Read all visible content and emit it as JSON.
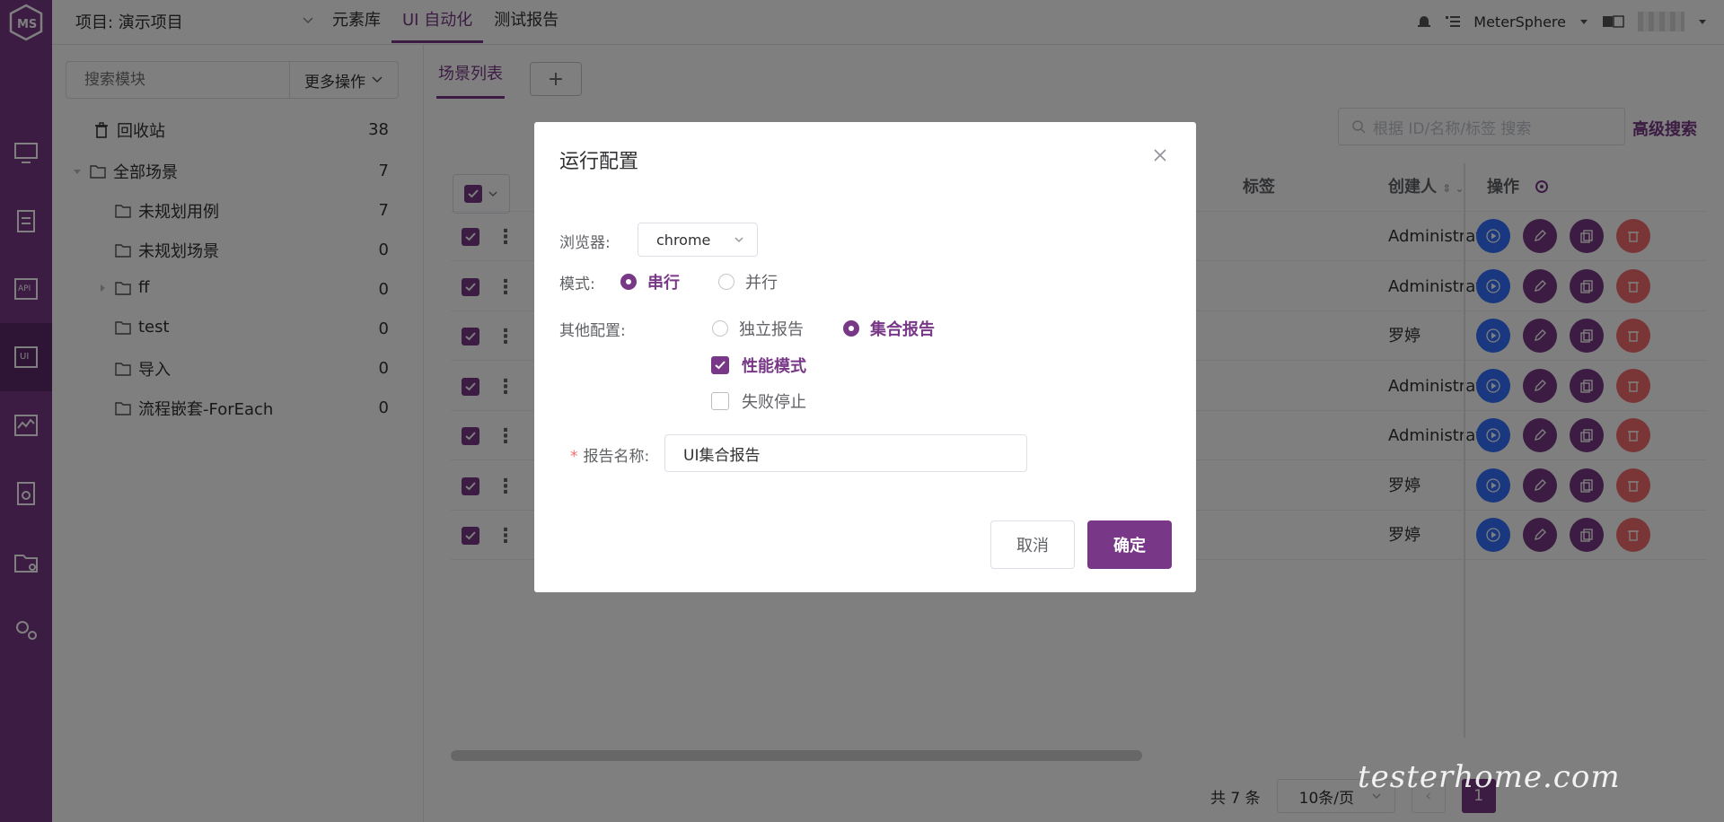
{
  "header": {
    "project_label": "项目: 演示项目",
    "nav": [
      "元素库",
      "UI 自动化",
      "测试报告"
    ],
    "workspace": "MeterSphere"
  },
  "tree": {
    "search_placeholder": "搜索模块",
    "more_ops": "更多操作",
    "nodes": [
      {
        "label": "回收站",
        "count": "38"
      },
      {
        "label": "全部场景",
        "count": "7"
      },
      {
        "label": "未规划用例",
        "count": "7"
      },
      {
        "label": "未规划场景",
        "count": "0"
      },
      {
        "label": "ff",
        "count": "0"
      },
      {
        "label": "test",
        "count": "0"
      },
      {
        "label": "导入",
        "count": "0"
      },
      {
        "label": "流程嵌套-ForEach",
        "count": "0"
      }
    ]
  },
  "main": {
    "tab": "场景列表",
    "add": "+",
    "search_placeholder": "根据 ID/名称/标签 搜索",
    "advanced_search": "高级搜索",
    "columns": {
      "tag": "标签",
      "creator": "创建人",
      "ops": "操作"
    },
    "rows": [
      {
        "creator": "Administrator"
      },
      {
        "creator": "Administrator"
      },
      {
        "creator": "罗婷"
      },
      {
        "creator": "Administrator"
      },
      {
        "creator": "Administrator"
      },
      {
        "creator": "罗婷"
      },
      {
        "creator": "罗婷"
      }
    ],
    "pager": {
      "total": "共 7 条",
      "page_size": "10条/页",
      "current": "1"
    }
  },
  "modal": {
    "title": "运行配置",
    "browser_label": "浏览器:",
    "browser_value": "chrome",
    "mode_label": "模式:",
    "mode_serial": "串行",
    "mode_parallel": "并行",
    "other_label": "其他配置:",
    "report_independent": "独立报告",
    "report_combined": "集合报告",
    "perf_mode": "性能模式",
    "fail_stop": "失败停止",
    "report_name_label": "报告名称:",
    "report_name_value": "UI集合报告",
    "cancel": "取消",
    "confirm": "确定"
  },
  "colors": {
    "accent": "#783887",
    "run": "#3370ff",
    "danger": "#f56c6c"
  },
  "watermark": "testerhome.com"
}
